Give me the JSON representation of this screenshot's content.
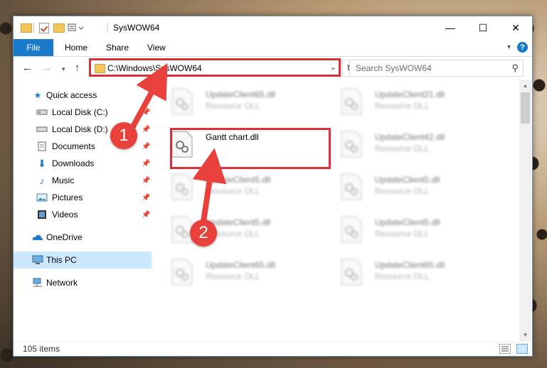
{
  "window": {
    "title": "SysWOW64",
    "controls": {
      "minimize": "—",
      "maximize": "☐",
      "close": "✕"
    }
  },
  "ribbon": {
    "tabs": [
      "File",
      "Home",
      "Share",
      "View"
    ],
    "help": "?"
  },
  "nav": {
    "address": "C:\\Windows\\SysWOW64",
    "search_placeholder": "Search SysWOW64"
  },
  "sidebar": {
    "items": [
      {
        "label": "Quick access",
        "icon": "star-icon"
      },
      {
        "label": "Local Disk (C:)",
        "icon": "drive-icon",
        "pinned": true
      },
      {
        "label": "Local Disk (D:)",
        "icon": "drive-icon",
        "pinned": true
      },
      {
        "label": "Documents",
        "icon": "documents-icon",
        "pinned": true
      },
      {
        "label": "Downloads",
        "icon": "downloads-icon",
        "pinned": true
      },
      {
        "label": "Music",
        "icon": "music-icon",
        "pinned": true
      },
      {
        "label": "Pictures",
        "icon": "pictures-icon",
        "pinned": true
      },
      {
        "label": "Videos",
        "icon": "videos-icon",
        "pinned": true
      },
      {
        "label": "OneDrive",
        "icon": "cloud-icon"
      },
      {
        "label": "This PC",
        "icon": "computer-icon",
        "selected": true
      },
      {
        "label": "Network",
        "icon": "network-icon"
      }
    ]
  },
  "files": [
    {
      "name": "UpdateClient65.dll",
      "type": "Resource DLL",
      "blurred": true
    },
    {
      "name": "UpdateClient21.dll",
      "type": "Resource DLL",
      "blurred": true
    },
    {
      "name": "Gantt chart.dll",
      "type": "",
      "blurred": false
    },
    {
      "name": "UpdateClient42.dll",
      "type": "Resource DLL",
      "blurred": true
    },
    {
      "name": "UpdateClient5.dll",
      "type": "Resource DLL",
      "blurred": true
    },
    {
      "name": "UpdateClient5.dll",
      "type": "Resource DLL",
      "blurred": true
    },
    {
      "name": "UpdateClient5.dll",
      "type": "Resource DLL",
      "blurred": true
    },
    {
      "name": "UpdateClient5.dll",
      "type": "Resource DLL",
      "blurred": true
    },
    {
      "name": "UpdateClient65.dll",
      "type": "Resource DLL",
      "blurred": true
    },
    {
      "name": "UpdateClient65.dll",
      "type": "Resource DLL",
      "blurred": true
    }
  ],
  "status": {
    "items": "105 items"
  },
  "annotations": {
    "step1": "1",
    "step2": "2"
  },
  "colors": {
    "accent": "#1979ca",
    "highlight": "#d9303a",
    "callout": "#e8413b",
    "selected": "#cce8ff"
  }
}
